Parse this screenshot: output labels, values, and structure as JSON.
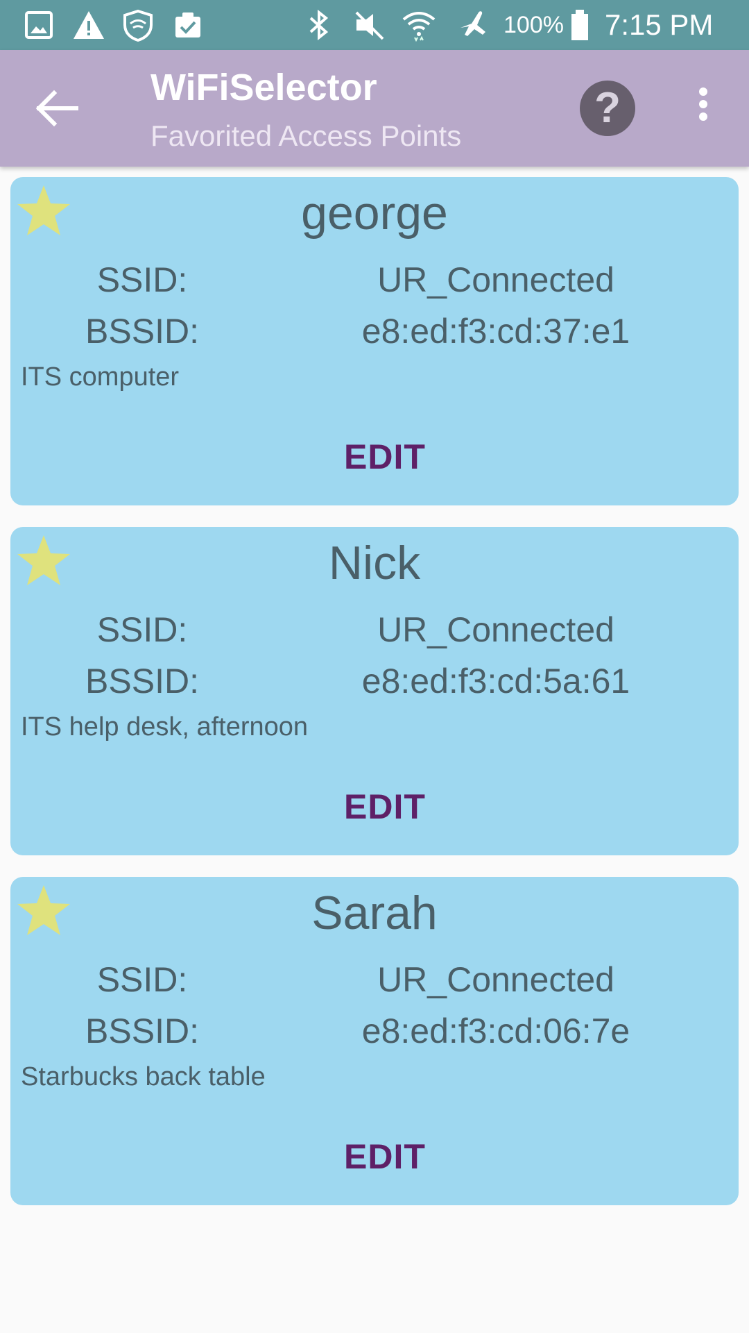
{
  "status_bar": {
    "battery": "100%",
    "time": "7:15 PM",
    "icons": [
      "gallery-icon",
      "warning-icon",
      "shield-wifi-icon",
      "clipboard-icon",
      "bluetooth-icon",
      "vibrate-off-icon",
      "wifi-icon",
      "airplane-icon",
      "battery-icon"
    ]
  },
  "app_bar": {
    "title": "WiFiSelector",
    "subtitle": "Favorited Access Points",
    "help_label": "?"
  },
  "labels": {
    "ssid": "SSID:",
    "bssid": "BSSID:",
    "edit": "EDIT"
  },
  "access_points": [
    {
      "name": "george",
      "ssid": "UR_Connected",
      "bssid": "e8:ed:f3:cd:37:e1",
      "note": "ITS computer"
    },
    {
      "name": "Nick",
      "ssid": "UR_Connected",
      "bssid": "e8:ed:f3:cd:5a:61",
      "note": "ITS help desk, afternoon"
    },
    {
      "name": "Sarah",
      "ssid": "UR_Connected",
      "bssid": "e8:ed:f3:cd:06:7e",
      "note": "Starbucks back table"
    }
  ],
  "colors": {
    "status_bar": "#5f9aa0",
    "app_bar": "#b8a9c9",
    "card": "#9ed8f0",
    "star": "#dfe27d",
    "edit": "#5e2067",
    "text": "#4a5f68"
  }
}
